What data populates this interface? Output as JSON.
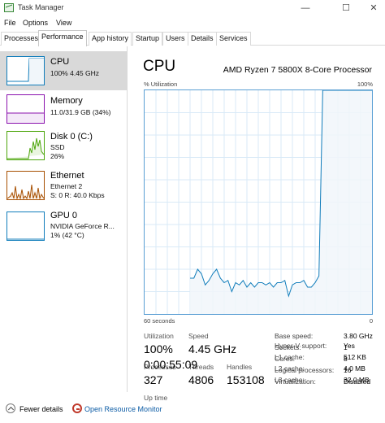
{
  "window": {
    "title": "Task Manager",
    "minimize": "—",
    "maximize": "☐",
    "close": "✕"
  },
  "menu": [
    "File",
    "Options",
    "View"
  ],
  "tabs": [
    "Processes",
    "Performance",
    "App history",
    "Startup",
    "Users",
    "Details",
    "Services"
  ],
  "active_tab": "Performance",
  "sidebar": [
    {
      "title": "CPU",
      "sub1": "100%  4.45 GHz",
      "sub2": "",
      "color": "#117dbb"
    },
    {
      "title": "Memory",
      "sub1": "11.0/31.9 GB (34%)",
      "sub2": "",
      "color": "#8b12ae"
    },
    {
      "title": "Disk 0 (C:)",
      "sub1": "SSD",
      "sub2": "26%",
      "color": "#4da60c"
    },
    {
      "title": "Ethernet",
      "sub1": "Ethernet 2",
      "sub2": "S: 0  R: 40.0 Kbps",
      "color": "#a74f01"
    },
    {
      "title": "GPU 0",
      "sub1": "NVIDIA GeForce R...",
      "sub2": "1%  (42 °C)",
      "color": "#117dbb"
    }
  ],
  "main": {
    "title": "CPU",
    "model": "AMD Ryzen 7 5800X 8-Core Processor",
    "util_label": "% Utilization",
    "util_max": "100%",
    "time_label": "60 seconds",
    "util_min": "0"
  },
  "chart_data": {
    "type": "line",
    "title": "",
    "xlabel": "60 seconds",
    "ylabel": "% Utilization",
    "ylim": [
      0,
      100
    ],
    "x": [
      0,
      1,
      2,
      3,
      4,
      5,
      6,
      7,
      8,
      9,
      10,
      11,
      12,
      13,
      14,
      15,
      16,
      17,
      18,
      19,
      20,
      21,
      22,
      23,
      24,
      25,
      26,
      27,
      28,
      29,
      30,
      31,
      32,
      33,
      34,
      35,
      36,
      37,
      38,
      39,
      40,
      41,
      42,
      43,
      44,
      45,
      46,
      47,
      48,
      49,
      50,
      51,
      52,
      53,
      54,
      55,
      56,
      57,
      58,
      59,
      60
    ],
    "series": [
      {
        "values": [
          null,
          null,
          null,
          null,
          null,
          null,
          null,
          null,
          null,
          null,
          null,
          null,
          16,
          16,
          20,
          18,
          13,
          15,
          18,
          20,
          16,
          14,
          15,
          10,
          14,
          13,
          15,
          12,
          14,
          12,
          14,
          14,
          13,
          14,
          12,
          14,
          14,
          15,
          8,
          13,
          14,
          14,
          15,
          12,
          12,
          14,
          17,
          100,
          100,
          100,
          100,
          100,
          100,
          100,
          100,
          100,
          100,
          100,
          100,
          100,
          100
        ]
      }
    ]
  },
  "stats": {
    "utilization_label": "Utilization",
    "utilization": "100%",
    "speed_label": "Speed",
    "speed": "4.45 GHz",
    "processes_label": "Processes",
    "processes": "327",
    "threads_label": "Threads",
    "threads": "4806",
    "handles_label": "Handles",
    "handles": "153108",
    "uptime_label": "Up time",
    "uptime": "0:00:55:09"
  },
  "specs": [
    {
      "label": "Base speed:",
      "value": "3.80 GHz"
    },
    {
      "label": "Sockets:",
      "value": "1"
    },
    {
      "label": "Cores:",
      "value": "8"
    },
    {
      "label": "Logical processors:",
      "value": "16"
    },
    {
      "label": "Virtualization:",
      "value": "Disabled"
    },
    {
      "label": "Hyper-V support:",
      "value": "Yes"
    },
    {
      "label": "L1 cache:",
      "value": "512 KB"
    },
    {
      "label": "L2 cache:",
      "value": "4.0 MB"
    },
    {
      "label": "L3 cache:",
      "value": "32.0 MB"
    }
  ],
  "footer": {
    "fewer": "Fewer details",
    "monitor": "Open Resource Monitor"
  }
}
